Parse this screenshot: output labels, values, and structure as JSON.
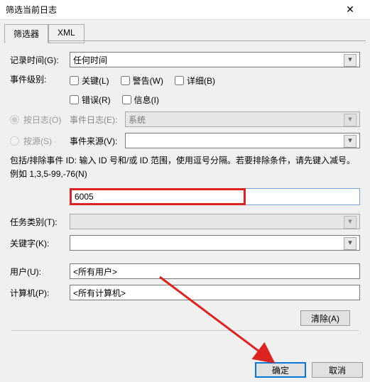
{
  "titlebar": {
    "title": "筛选当前日志"
  },
  "tabs": {
    "items": [
      {
        "label": "筛选器",
        "active": true
      },
      {
        "label": "XML",
        "active": false
      }
    ]
  },
  "form": {
    "logged_label": "记录时间(G):",
    "logged_value": "任何时间",
    "level_label": "事件级别:",
    "levels": {
      "critical": "关键(L)",
      "warning": "警告(W)",
      "verbose": "详细(B)",
      "error": "错误(R)",
      "information": "信息(I)"
    },
    "bylog_label": "按日志(O)",
    "eventlog_label": "事件日志(E):",
    "eventlog_value": "系统",
    "bysource_label": "按源(S)",
    "eventsource_label": "事件来源(V):",
    "eventsource_value": "",
    "id_help": "包括/排除事件 ID: 输入 ID 号和/或 ID 范围，使用逗号分隔。若要排除条件，请先键入减号。例如 1,3,5-99,-76(N)",
    "id_value": "6005",
    "taskcat_label": "任务类别(T):",
    "keywords_label": "关键字(K):",
    "user_label": "用户(U):",
    "user_value": "<所有用户>",
    "computer_label": "计算机(P):",
    "computer_value": "<所有计算机>"
  },
  "buttons": {
    "clear": "清除(A)",
    "ok": "确定",
    "cancel": "取消"
  }
}
